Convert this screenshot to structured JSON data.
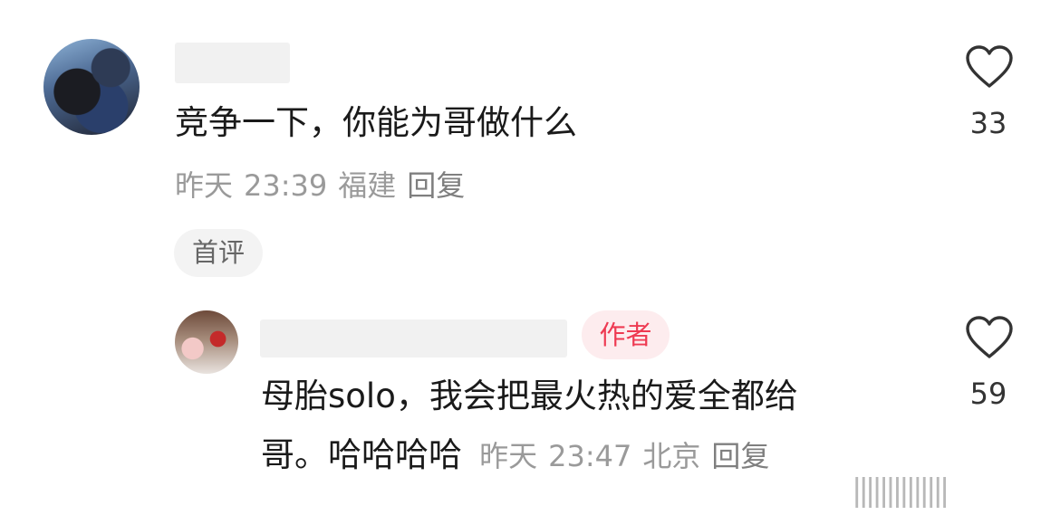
{
  "comments": [
    {
      "text": "竞争一下，你能为哥做什么",
      "date": "昨天",
      "time": "23:39",
      "location": "福建",
      "reply_label": "回复",
      "badge": "首评",
      "like_count": "33"
    },
    {
      "author_badge": "作者",
      "text_line1": "母胎solo，我会把最火热的爱全都给",
      "text_line2": "哥。哈哈哈哈",
      "date": "昨天",
      "time": "23:47",
      "location": "北京",
      "reply_label": "回复",
      "like_count": "59"
    }
  ],
  "colors": {
    "author_badge_text": "#ee3a52",
    "author_badge_bg": "#fdecee",
    "meta_gray": "#9a9a9a"
  },
  "watermark": "||||||||||||||"
}
